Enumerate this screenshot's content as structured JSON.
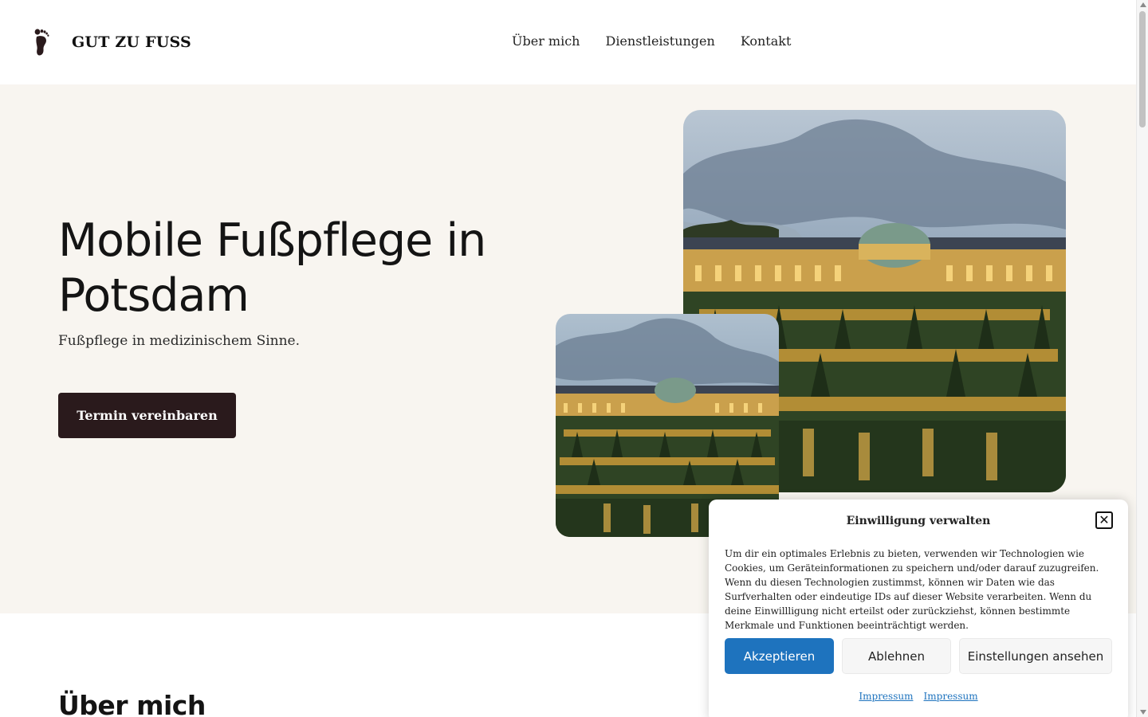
{
  "header": {
    "logo_text": "GUT ZU FUSS",
    "logo_icon": "footprint-icon",
    "nav": [
      {
        "label": "Über mich"
      },
      {
        "label": "Dienstleistungen"
      },
      {
        "label": "Kontakt"
      }
    ]
  },
  "hero": {
    "title": "Mobile Fußpflege in Potsdam",
    "subtitle": "Fußpflege in medizinischem Sinne.",
    "cta_label": "Termin vereinbaren",
    "images": [
      "palace-photo-large",
      "palace-photo-small"
    ]
  },
  "about": {
    "title": "Über mich"
  },
  "consent": {
    "title": "Einwilligung verwalten",
    "text": "Um dir ein optimales Erlebnis zu bieten, verwenden wir Technologien wie Cookies, um Geräteinformationen zu speichern und/oder darauf zuzugreifen. Wenn du diesen Technologien zustimmst, können wir Daten wie das Surfverhalten oder eindeutige IDs auf dieser Website verarbeiten. Wenn du deine Einwillligung nicht erteilst oder zurückziehst, können bestimmte Merkmale und Funktionen beeinträchtigt werden.",
    "accept_label": "Akzeptieren",
    "deny_label": "Ablehnen",
    "preferences_label": "Einstellungen ansehen",
    "links": [
      "Impressum",
      "Impressum"
    ]
  },
  "colors": {
    "hero_background": "#f8f5f0",
    "cta_background": "#2a1a1c",
    "accept_blue": "#1e73be"
  }
}
